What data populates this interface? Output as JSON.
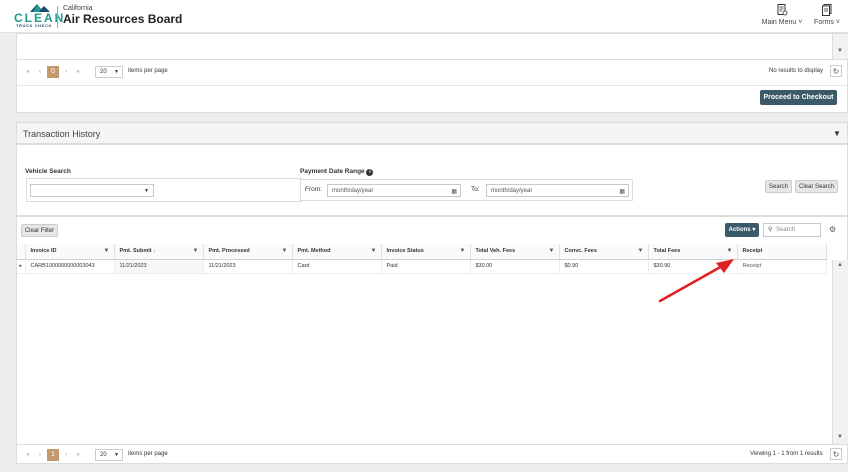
{
  "header": {
    "logo_text": "CLEAN",
    "logo_sub": "TRUCK CHECK",
    "org_small": "California",
    "org_big": "Air Resources Board",
    "main_menu": "Main Menu",
    "forms": "Forms"
  },
  "top_pager": {
    "page": "0",
    "page_size": "20",
    "items_per_page": "items per page",
    "status": "No results to display"
  },
  "checkout_button": "Proceed to Checkout",
  "transaction_history": {
    "title": "Transaction History",
    "vehicle_search_label": "Vehicle Search",
    "payment_date_label": "Payment Date Range",
    "from_label": "From:",
    "to_label": "To:",
    "from_placeholder": "month/day/year",
    "to_placeholder": "month/day/year",
    "search_button": "Search",
    "clear_search_button": "Clear Search",
    "clear_filter_button": "Clear Filter",
    "actions_button": "Actions",
    "search_placeholder": "Search",
    "columns": [
      "Invoice ID",
      "Pmt. Submit",
      "Pmt. Processed",
      "Pmt. Method",
      "Invoice Status",
      "Total Veh. Fees",
      "Convc. Fees",
      "Total Fees",
      "Receipt"
    ],
    "rows": [
      {
        "invoice_id": "CARB1000000000003043",
        "pmt_submit": "11/21/2023",
        "pmt_processed": "11/21/2023",
        "pmt_method": "Card",
        "invoice_status": "Paid",
        "total_veh_fees": "$30.00",
        "convc_fees": "$0.90",
        "total_fees": "$30.90",
        "receipt": "Receipt"
      }
    ],
    "pager": {
      "page": "1",
      "page_size": "20",
      "items_per_page": "items per page",
      "status": "Viewing 1 - 1 from 1 results"
    }
  },
  "colors": {
    "accent_dark": "#3a5a6a",
    "pager_active": "#c49a6c",
    "logo_green": "#1f9a8c",
    "arrow": "#e02020"
  }
}
